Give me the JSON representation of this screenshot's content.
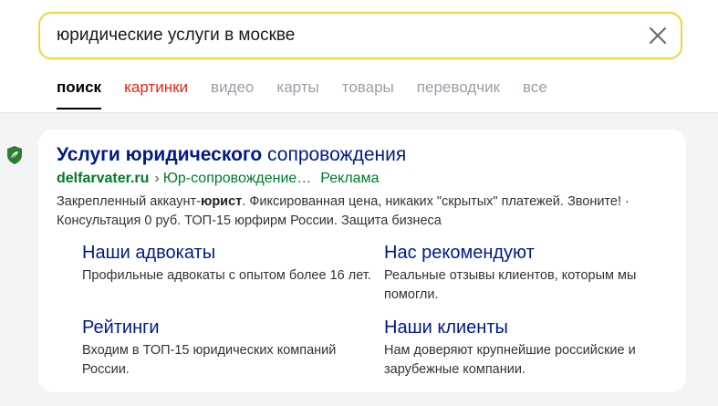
{
  "search": {
    "query": "юридические услуги в москве"
  },
  "tabs": [
    {
      "label": "поиск"
    },
    {
      "label": "картинки"
    },
    {
      "label": "видео"
    },
    {
      "label": "карты"
    },
    {
      "label": "товары"
    },
    {
      "label": "переводчик"
    },
    {
      "label": "все"
    }
  ],
  "ad": {
    "title_bold": "Услуги юридического",
    "title_rest": " сопровождения",
    "domain": "delfarvater.ru",
    "separator": "›",
    "path": "Юр-сопровождение…",
    "ad_label": "Реклама",
    "desc_part1": "Закрепленный аккаунт-",
    "desc_bold": "юрист",
    "desc_part2": ". Фиксированная цена, никаких \"скрытых\" платежей. Звоните! · Консультация 0 руб. ТОП-15 юрфирм России. Защита бизнеса",
    "sitelinks": [
      {
        "title": "Наши адвокаты",
        "desc": "Профильные адвокаты с опытом более 16 лет."
      },
      {
        "title": "Нас рекомендуют",
        "desc": "Реальные отзывы клиентов, которым мы помогли."
      },
      {
        "title": "Рейтинги",
        "desc": "Входим в ТОП-15 юридических компаний России."
      },
      {
        "title": "Наши клиенты",
        "desc": "Нам доверяют крупнейшие российские и зарубежные компании."
      }
    ]
  },
  "colors": {
    "search_border": "#f5d33b",
    "link": "#001a88",
    "url": "#007a2e",
    "tab_highlight": "#e3261a"
  }
}
